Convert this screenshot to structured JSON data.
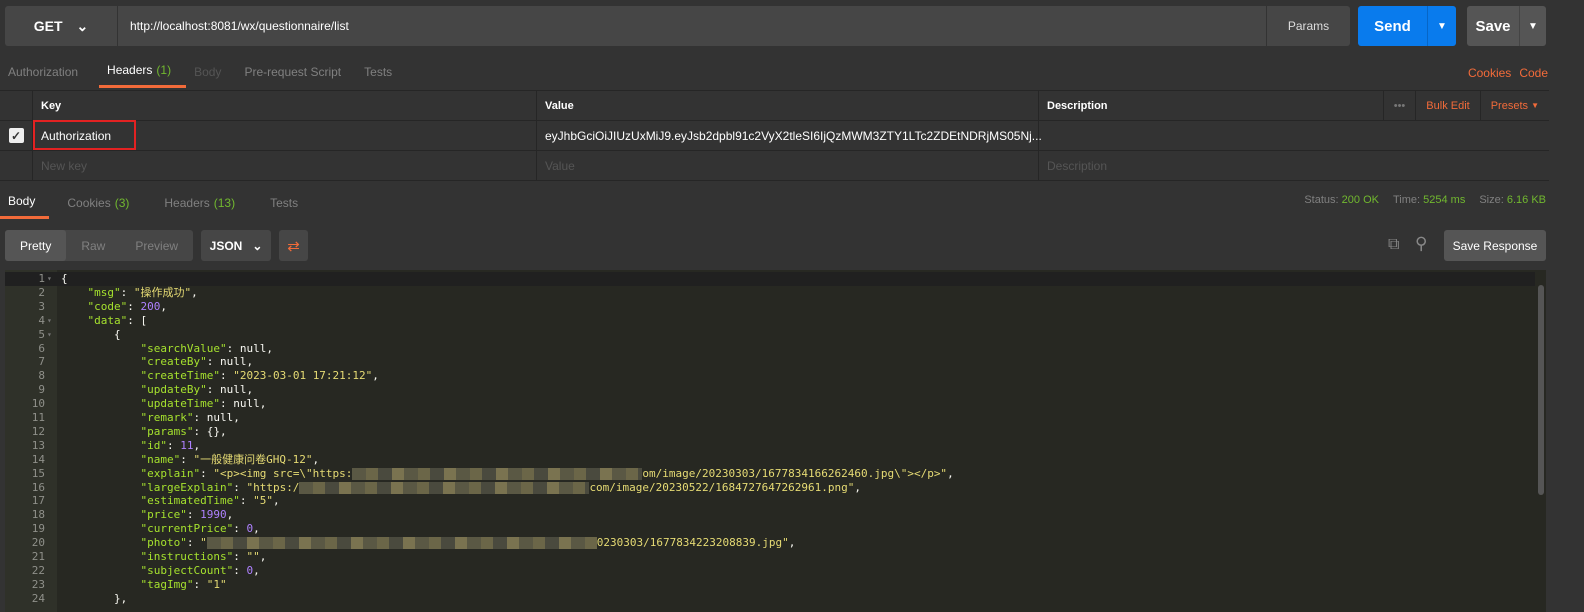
{
  "request": {
    "method": "GET",
    "url": "http://localhost:8081/wx/questionnaire/list",
    "params_label": "Params",
    "send_label": "Send",
    "save_label": "Save"
  },
  "req_tabs": [
    {
      "label": "Authorization"
    },
    {
      "label": "Headers",
      "count": "(1)"
    },
    {
      "label": "Body"
    },
    {
      "label": "Pre-request Script"
    },
    {
      "label": "Tests"
    }
  ],
  "req_links": {
    "cookies": "Cookies",
    "code": "Code"
  },
  "headers_table": {
    "columns": [
      "Key",
      "Value",
      "Description"
    ],
    "bulk_edit": "Bulk Edit",
    "presets": "Presets",
    "rows": [
      {
        "checked": true,
        "key": "Authorization",
        "value": "eyJhbGciOiJIUzUxMiJ9.eyJsb2dpbl91c2VyX2tleSI6IjQzMWM3ZTY1LTc2ZDEtNDRjMS05Nj...",
        "description": ""
      }
    ],
    "new_row": {
      "key": "New key",
      "value": "Value",
      "description": "Description"
    }
  },
  "resp_tabs": [
    {
      "label": "Body"
    },
    {
      "label": "Cookies",
      "count": "(3)"
    },
    {
      "label": "Headers",
      "count": "(13)"
    },
    {
      "label": "Tests"
    }
  ],
  "status": {
    "status_label": "Status:",
    "status": "200 OK",
    "time_label": "Time:",
    "time": "5254 ms",
    "size_label": "Size:",
    "size": "6.16 KB"
  },
  "view": {
    "modes": [
      "Pretty",
      "Raw",
      "Preview"
    ],
    "format": "JSON",
    "save_response": "Save Response"
  },
  "colors": {
    "accent": "#f26b3a",
    "send": "#097bed",
    "success": "#71b82f",
    "json_key": "#a6e22e",
    "json_string": "#e6db74",
    "json_number": "#ae81ff"
  },
  "body_lines": [
    {
      "n": "1",
      "fold": true,
      "indent": 0,
      "parts": [
        [
          "p",
          "{"
        ]
      ]
    },
    {
      "n": "2",
      "indent": 1,
      "parts": [
        [
          "k",
          "\"msg\""
        ],
        [
          "p",
          ": "
        ],
        [
          "s",
          "\"操作成功\""
        ],
        [
          "p",
          ","
        ]
      ]
    },
    {
      "n": "3",
      "indent": 1,
      "parts": [
        [
          "k",
          "\"code\""
        ],
        [
          "p",
          ": "
        ],
        [
          "n",
          "200"
        ],
        [
          "p",
          ","
        ]
      ]
    },
    {
      "n": "4",
      "fold": true,
      "indent": 1,
      "parts": [
        [
          "k",
          "\"data\""
        ],
        [
          "p",
          ": ["
        ]
      ]
    },
    {
      "n": "5",
      "fold": true,
      "indent": 2,
      "parts": [
        [
          "p",
          "{"
        ]
      ]
    },
    {
      "n": "6",
      "indent": 3,
      "parts": [
        [
          "k",
          "\"searchValue\""
        ],
        [
          "p",
          ": null,"
        ]
      ]
    },
    {
      "n": "7",
      "indent": 3,
      "parts": [
        [
          "k",
          "\"createBy\""
        ],
        [
          "p",
          ": null,"
        ]
      ]
    },
    {
      "n": "8",
      "indent": 3,
      "parts": [
        [
          "k",
          "\"createTime\""
        ],
        [
          "p",
          ": "
        ],
        [
          "s",
          "\"2023-03-01 17:21:12\""
        ],
        [
          "p",
          ","
        ]
      ]
    },
    {
      "n": "9",
      "indent": 3,
      "parts": [
        [
          "k",
          "\"updateBy\""
        ],
        [
          "p",
          ": null,"
        ]
      ]
    },
    {
      "n": "10",
      "indent": 3,
      "parts": [
        [
          "k",
          "\"updateTime\""
        ],
        [
          "p",
          ": null,"
        ]
      ]
    },
    {
      "n": "11",
      "indent": 3,
      "parts": [
        [
          "k",
          "\"remark\""
        ],
        [
          "p",
          ": null,"
        ]
      ]
    },
    {
      "n": "12",
      "indent": 3,
      "parts": [
        [
          "k",
          "\"params\""
        ],
        [
          "p",
          ": {},"
        ]
      ]
    },
    {
      "n": "13",
      "indent": 3,
      "parts": [
        [
          "k",
          "\"id\""
        ],
        [
          "p",
          ": "
        ],
        [
          "n",
          "11"
        ],
        [
          "p",
          ","
        ]
      ]
    },
    {
      "n": "14",
      "indent": 3,
      "parts": [
        [
          "k",
          "\"name\""
        ],
        [
          "p",
          ": "
        ],
        [
          "s",
          "\"一般健康问卷GHQ-12\""
        ],
        [
          "p",
          ","
        ]
      ]
    },
    {
      "n": "15",
      "indent": 3,
      "parts": [
        [
          "k",
          "\"explain\""
        ],
        [
          "p",
          ": "
        ],
        [
          "s",
          "\"<p><img src=\\\"https:"
        ],
        [
          "blur",
          "290"
        ],
        [
          "s",
          "om/image/20230303/1677834166262460.jpg\\\"></p>\""
        ],
        [
          "p",
          ","
        ]
      ]
    },
    {
      "n": "16",
      "indent": 3,
      "parts": [
        [
          "k",
          "\"largeExplain\""
        ],
        [
          "p",
          ": "
        ],
        [
          "s",
          "\"https:/"
        ],
        [
          "blur",
          "290"
        ],
        [
          "s",
          "com/image/20230522/1684727647262961.png\""
        ],
        [
          "p",
          ","
        ]
      ]
    },
    {
      "n": "17",
      "indent": 3,
      "parts": [
        [
          "k",
          "\"estimatedTime\""
        ],
        [
          "p",
          ": "
        ],
        [
          "s",
          "\"5\""
        ],
        [
          "p",
          ","
        ]
      ]
    },
    {
      "n": "18",
      "indent": 3,
      "parts": [
        [
          "k",
          "\"price\""
        ],
        [
          "p",
          ": "
        ],
        [
          "n",
          "1990"
        ],
        [
          "p",
          ","
        ]
      ]
    },
    {
      "n": "19",
      "indent": 3,
      "parts": [
        [
          "k",
          "\"currentPrice\""
        ],
        [
          "p",
          ": "
        ],
        [
          "n",
          "0"
        ],
        [
          "p",
          ","
        ]
      ]
    },
    {
      "n": "20",
      "indent": 3,
      "parts": [
        [
          "k",
          "\"photo\""
        ],
        [
          "p",
          ": "
        ],
        [
          "s",
          "\""
        ],
        [
          "blur",
          "390"
        ],
        [
          "s",
          "0230303/1677834223208839.jpg\""
        ],
        [
          "p",
          ","
        ]
      ]
    },
    {
      "n": "21",
      "indent": 3,
      "parts": [
        [
          "k",
          "\"instructions\""
        ],
        [
          "p",
          ": "
        ],
        [
          "s",
          "\"\""
        ],
        [
          "p",
          ","
        ]
      ]
    },
    {
      "n": "22",
      "indent": 3,
      "parts": [
        [
          "k",
          "\"subjectCount\""
        ],
        [
          "p",
          ": "
        ],
        [
          "n",
          "0"
        ],
        [
          "p",
          ","
        ]
      ]
    },
    {
      "n": "23",
      "indent": 3,
      "parts": [
        [
          "k",
          "\"tagImg\""
        ],
        [
          "p",
          ": "
        ],
        [
          "s",
          "\"1\""
        ]
      ]
    },
    {
      "n": "24",
      "indent": 2,
      "parts": [
        [
          "p",
          "},"
        ]
      ]
    }
  ]
}
